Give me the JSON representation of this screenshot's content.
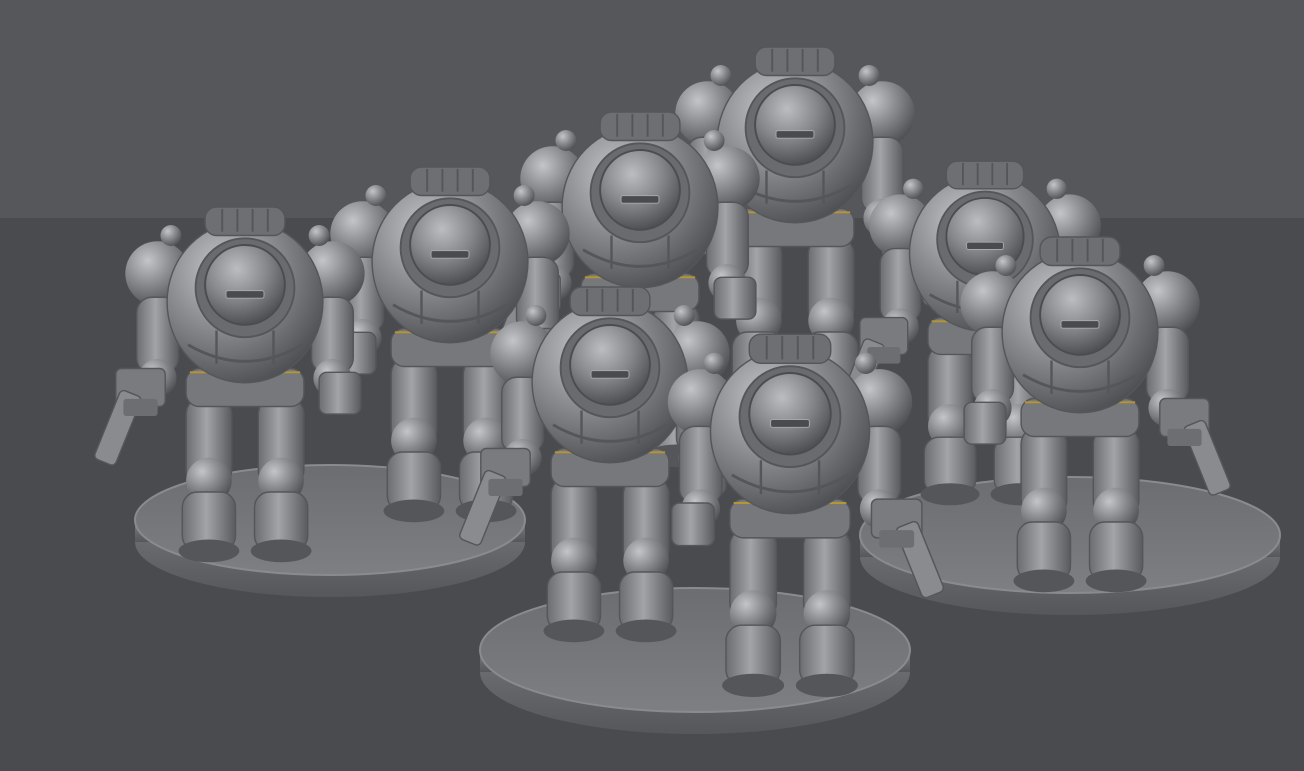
{
  "scene": {
    "subject": "miniature-figures",
    "figure_count": 8,
    "base_count": 3,
    "colors": {
      "backdrop": "#56575a",
      "floor": "#4a4b4e",
      "model": "#8e8f92",
      "model_light": "#b9babd",
      "model_dark": "#55565a",
      "trim": "#b8962f"
    }
  }
}
